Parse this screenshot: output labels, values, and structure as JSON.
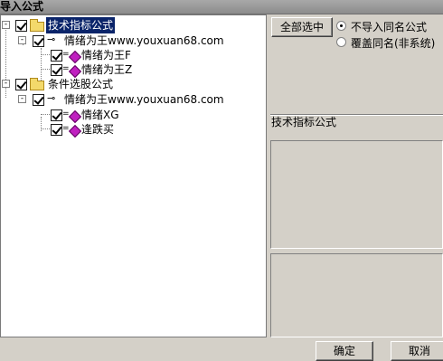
{
  "window": {
    "title": "导入公式"
  },
  "tree": {
    "group1": {
      "label": "技术指标公式",
      "author": "情绪为王www.youxuan68.com",
      "items": [
        "情绪为王F",
        "情绪为王Z"
      ]
    },
    "group2": {
      "label": "条件选股公式",
      "author": "情绪为王www.youxuan68.com",
      "items": [
        "情绪XG",
        "逢跌买"
      ]
    }
  },
  "options": {
    "select_all_label": "全部选中",
    "radio1_label": "不导入同名公式",
    "radio2_label": "覆盖同名(非系统)",
    "selected": "radio1"
  },
  "detail": {
    "section_label": "技术指标公式"
  },
  "footer": {
    "ok_label": "确定",
    "cancel_label": "取消"
  },
  "colors": {
    "selection": "#0a246a",
    "formula_icon": "#c020c0",
    "folder": "#f3d96b"
  }
}
